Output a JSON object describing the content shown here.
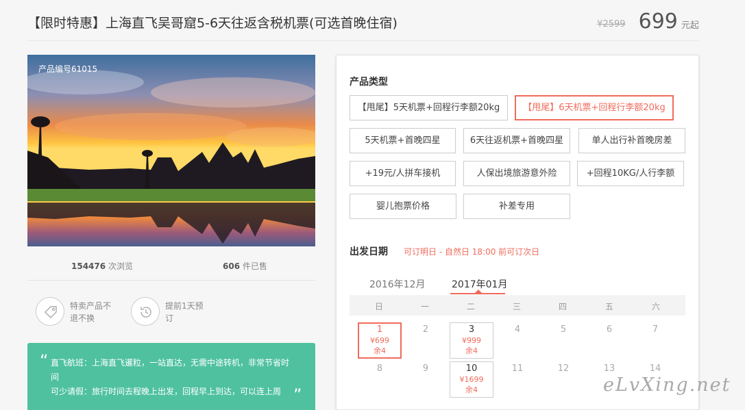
{
  "header": {
    "title": "【限时特惠】上海直飞吴哥窟5-6天往返含税机票(可选首晚住宿)",
    "old_price": "¥2599",
    "price": "699",
    "price_unit": "元起"
  },
  "photo": {
    "code": "产品编号61015"
  },
  "stats": {
    "views_count": "154476",
    "views_label": "次浏览",
    "sold_count": "606",
    "sold_label": "件已售"
  },
  "promises": [
    {
      "text": "特卖产品不退不换",
      "icon": "tag-icon"
    },
    {
      "text": "提前1天预订",
      "icon": "clock-icon"
    }
  ],
  "highlight": {
    "line1": "直飞航班：上海直飞暹粒，一站直达，无需中途转机，非常节省时间",
    "line2": "可少请假：旅行时间去程晚上出发，回程早上到达，可以连上周"
  },
  "booking": {
    "product_type_title": "产品类型",
    "options": [
      {
        "label": "【甩尾】5天机票+回程行李额20kg",
        "selected": false
      },
      {
        "label": "【甩尾】6天机票+回程行李额20kg",
        "selected": true
      },
      {
        "label": "5天机票+首晚四星",
        "selected": false
      },
      {
        "label": "6天往返机票+首晚四星",
        "selected": false
      },
      {
        "label": "单人出行补首晚房差",
        "selected": false
      },
      {
        "label": "+19元/人拼车接机",
        "selected": false
      },
      {
        "label": "人保出境旅游意外险",
        "selected": false
      },
      {
        "label": "+回程10KG/人行李额",
        "selected": false
      },
      {
        "label": "婴儿抱票价格",
        "selected": false
      },
      {
        "label": "补差专用",
        "selected": false
      }
    ],
    "date_title": "出发日期",
    "date_note": "可订明日 - 自然日 18:00 前可订次日",
    "months": [
      "2016年12月",
      "2017年01月"
    ],
    "active_month_index": 1,
    "weekdays": [
      "日",
      "一",
      "二",
      "三",
      "四",
      "五",
      "六"
    ],
    "days_row1": [
      {
        "day": "1",
        "price": "¥699",
        "remain": "余4",
        "selected": true
      },
      {
        "day": "2"
      },
      {
        "day": "3",
        "price": "¥999",
        "remain": "余4"
      },
      {
        "day": "4"
      },
      {
        "day": "5"
      },
      {
        "day": "6"
      },
      {
        "day": "7"
      }
    ],
    "days_row2": [
      {
        "day": "8"
      },
      {
        "day": "9"
      },
      {
        "day": "10",
        "price": "¥1699",
        "remain": "余4"
      },
      {
        "day": "11"
      },
      {
        "day": "12"
      },
      {
        "day": "13"
      },
      {
        "day": "14"
      }
    ]
  },
  "watermark": "eLvXing.net",
  "colors": {
    "accent": "#f06b5b",
    "green": "#4fc19f"
  }
}
